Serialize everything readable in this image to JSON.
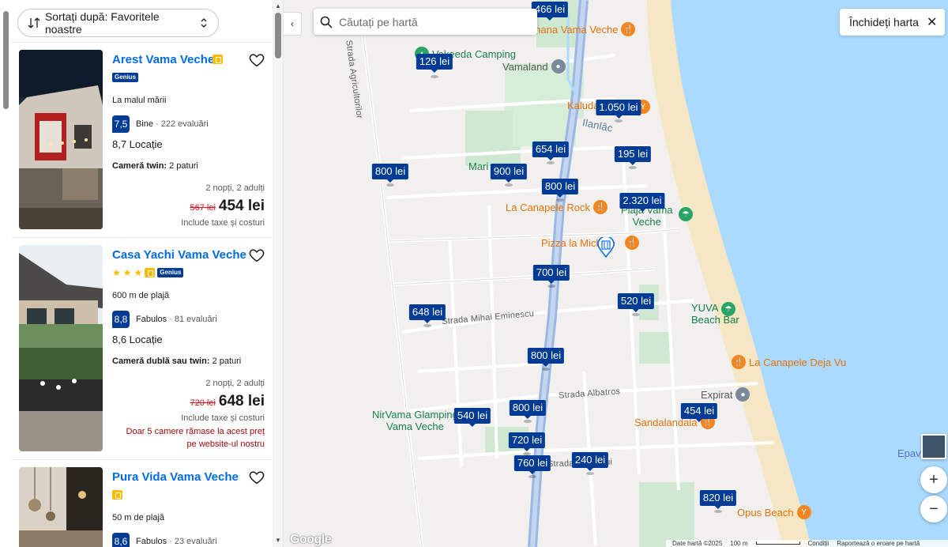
{
  "sidebar": {
    "sort_label": "Sortați după: Favoritele noastre",
    "cards": [
      {
        "title": "Arest Vama Veche",
        "stars": 0,
        "genius": "Genius",
        "location": "La malul mării",
        "score": "7,5",
        "score_word": "Bine",
        "reviews": "· 222 evaluări",
        "location_score": "8,7 Locație",
        "room_type": "Cameră twin:",
        "room_beds": " 2 paturi",
        "stay": "2 nopți, 2 adulți",
        "old_price": "567 lei",
        "price": "454 lei",
        "taxes": "Include taxe și costuri"
      },
      {
        "title": "Casa Yachi Vama Veche",
        "stars": 3,
        "genius": "Genius",
        "location": "600 m de plajă",
        "score": "8,8",
        "score_word": "Fabulos",
        "reviews": "· 81 evaluări",
        "location_score": "8,6 Locație",
        "room_type": "Cameră dublă sau twin:",
        "room_beds": " 2 paturi",
        "stay": "2 nopți, 2 adulți",
        "old_price": "720 lei",
        "price": "648 lei",
        "taxes": "Include taxe și costuri",
        "scarcity_1": "Doar 5 camere rămase la acest preț",
        "scarcity_2": "pe website-ul nostru"
      },
      {
        "title": "Pura Vida Vama Veche",
        "location": "50 m de plajă",
        "score": "8,6",
        "score_word": "Fabulos",
        "reviews": "· 23 evaluări"
      }
    ]
  },
  "map": {
    "search_placeholder": "Căutați pe hartă",
    "close_label": "Închideți harta",
    "markers": [
      "466 lei",
      "126 lei",
      "1.050 lei",
      "654 lei",
      "195 lei",
      "800 lei",
      "900 lei",
      "800 lei",
      "2.320 lei",
      "700 lei",
      "648 lei",
      "520 lei",
      "800 lei",
      "800 lei",
      "540 lei",
      "454 lei",
      "720 lei",
      "760 lei",
      "240 lei",
      "820 lei"
    ],
    "pois": {
      "p1": "Cherhana Vama Veche",
      "p2": "Vakeeda Camping",
      "p3": "Vamaland",
      "p4": "Kaluda",
      "p5": "Mari",
      "p6": "La Canapele Rock",
      "p7a": "Plaja Vama",
      "p7b": "Veche",
      "p8": "Pizza la Michele",
      "p9a": "YUVA",
      "p9b": "Beach Bar",
      "p10": "La Canapele Deja Vu",
      "p11": "Expirat",
      "p12": "Sandalandala",
      "p13a": "NirVama Glamping",
      "p13b": "Vama Veche",
      "p14": "Opus Beach",
      "p15": "Epav"
    },
    "streets": {
      "s1": "Strada Agricultorilor",
      "s2": "Ilanlâc",
      "s3": "Strada Mihai Eminescu",
      "s4": "Strada Albatros",
      "s5": "Strada Ieșușului"
    },
    "google": "Google",
    "attribution": {
      "data": "Date hartă ©2025",
      "scale": "100 m",
      "terms": "Condiții",
      "report": "Raportează o eroare pe hartă"
    },
    "zoom_in": "+",
    "zoom_out": "−"
  },
  "colors": {
    "accent": "#006ce4",
    "marker": "#003b95",
    "sea": "#aadaff",
    "beach": "#f5e6c4",
    "green": "#c8e6c9",
    "road": "#9bb7e3"
  }
}
